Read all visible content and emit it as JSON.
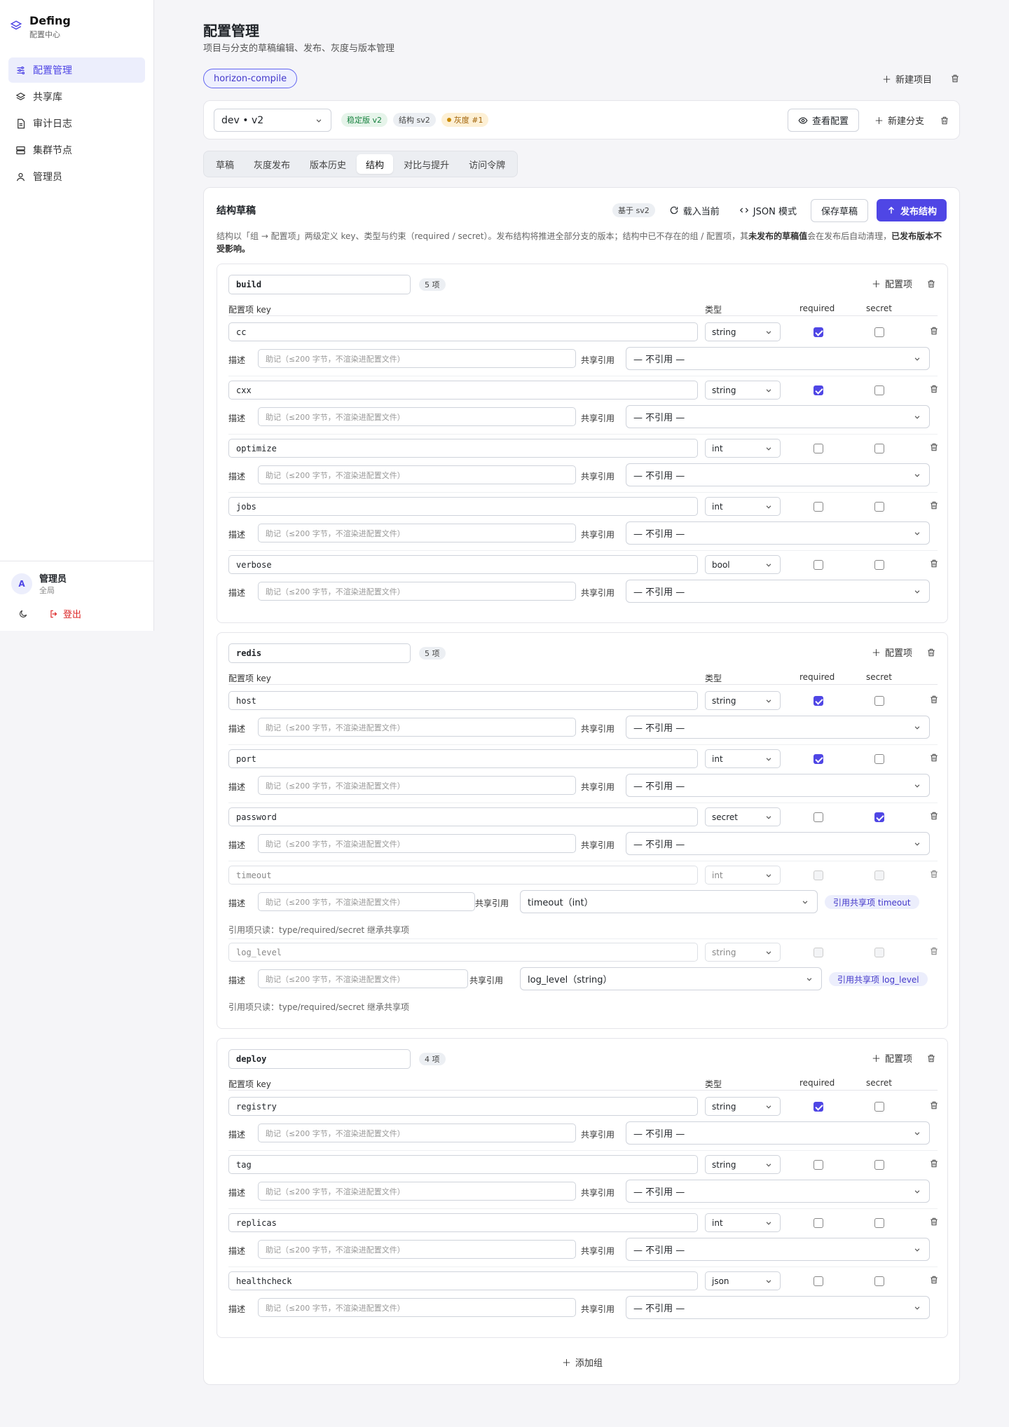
{
  "sidebar": {
    "brand": {
      "name": "Defing",
      "subtitle": "配置中心"
    },
    "items": [
      {
        "label": "配置管理",
        "icon": "sliders-icon",
        "active": true
      },
      {
        "label": "共享库",
        "icon": "layers-icon",
        "active": false
      },
      {
        "label": "审计日志",
        "icon": "document-icon",
        "active": false
      },
      {
        "label": "集群节点",
        "icon": "server-icon",
        "active": false
      },
      {
        "label": "管理员",
        "icon": "user-icon",
        "active": false
      }
    ],
    "user": {
      "initial": "A",
      "name": "管理员",
      "role": "全局"
    },
    "logout_label": "登出"
  },
  "page": {
    "title": "配置管理",
    "subtitle": "项目与分支的草稿编辑、发布、灰度与版本管理",
    "project": "horizon-compile",
    "new_project_label": "新建项目"
  },
  "branch": {
    "selected": "dev • v2",
    "badges": {
      "stable": "稳定版 v2",
      "schema": "结构 sv2",
      "gray": "灰度 #1"
    },
    "view_config_label": "查看配置",
    "new_branch_label": "新建分支"
  },
  "tabs": [
    "草稿",
    "灰度发布",
    "版本历史",
    "结构",
    "对比与提升",
    "访问令牌"
  ],
  "active_tab": "结构",
  "schema": {
    "title": "结构草稿",
    "base_badge": "基于 sv2",
    "load_current_label": "载入当前",
    "json_mode_label": "JSON 模式",
    "save_draft_label": "保存草稿",
    "publish_label": "发布结构",
    "desc_prefix": "结构以「组 → 配置项」两级定义 key、类型与约束（required / secret）。发布结构将推进全部分支的版本；结构中已不存在的组 / 配置项，其",
    "desc_bold1": "未发布的草稿值",
    "desc_mid": "会在发布后自动清理，",
    "desc_bold2": "已发布版本不受影响。",
    "col_key": "配置项 key",
    "col_type": "类型",
    "col_required": "required",
    "col_secret": "secret",
    "add_item_label": "配置项",
    "desc_label": "描述",
    "desc_placeholder": "助记（≤200 字节，不渲染进配置文件）",
    "share_label": "共享引用",
    "no_ref": "— 不引用 —",
    "ref_note": "引用项只读：type/required/secret 继承共享项",
    "add_group_label": "添加组",
    "groups": [
      {
        "name": "build",
        "count": "5 项",
        "items": [
          {
            "key": "cc",
            "type": "string",
            "required": true,
            "secret": false
          },
          {
            "key": "cxx",
            "type": "string",
            "required": true,
            "secret": false
          },
          {
            "key": "optimize",
            "type": "int",
            "required": false,
            "secret": false
          },
          {
            "key": "jobs",
            "type": "int",
            "required": false,
            "secret": false
          },
          {
            "key": "verbose",
            "type": "bool",
            "required": false,
            "secret": false
          }
        ]
      },
      {
        "name": "redis",
        "count": "5 项",
        "items": [
          {
            "key": "host",
            "type": "string",
            "required": true,
            "secret": false
          },
          {
            "key": "port",
            "type": "int",
            "required": true,
            "secret": false
          },
          {
            "key": "password",
            "type": "secret",
            "required": false,
            "secret": true
          },
          {
            "key": "timeout",
            "type": "int",
            "required": false,
            "secret": false,
            "ref": "timeout（int）",
            "ref_badge": "引用共享项 timeout"
          },
          {
            "key": "log_level",
            "type": "string",
            "required": false,
            "secret": false,
            "ref": "log_level（string）",
            "ref_badge": "引用共享项 log_level"
          }
        ]
      },
      {
        "name": "deploy",
        "count": "4 项",
        "items": [
          {
            "key": "registry",
            "type": "string",
            "required": true,
            "secret": false
          },
          {
            "key": "tag",
            "type": "string",
            "required": false,
            "secret": false
          },
          {
            "key": "replicas",
            "type": "int",
            "required": false,
            "secret": false
          },
          {
            "key": "healthcheck",
            "type": "json",
            "required": false,
            "secret": false
          }
        ]
      }
    ]
  },
  "colors": {
    "accent": "#4f46e5",
    "danger": "#dc2626"
  }
}
